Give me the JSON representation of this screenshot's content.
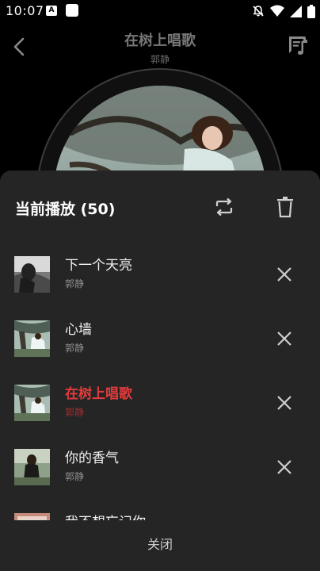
{
  "status_bar": {
    "time": "10:07",
    "notification_icon": "a-icon",
    "icons": [
      "mute-icon",
      "wifi-icon",
      "signal-icon",
      "battery-icon"
    ]
  },
  "player": {
    "title": "在树上唱歌",
    "artist": "郭静"
  },
  "playlist_sheet": {
    "title": "当前播放 (50)",
    "accent_color": "#e33b3b",
    "songs": [
      {
        "name": "下一个天亮",
        "artist": "郭静",
        "active": false
      },
      {
        "name": "心墙",
        "artist": "郭静",
        "active": false
      },
      {
        "name": "在树上唱歌",
        "artist": "郭静",
        "active": true
      },
      {
        "name": "你的香气",
        "artist": "郭静",
        "active": false
      },
      {
        "name": "我不想忘记你",
        "artist": "",
        "active": false
      }
    ],
    "close_label": "关闭"
  }
}
